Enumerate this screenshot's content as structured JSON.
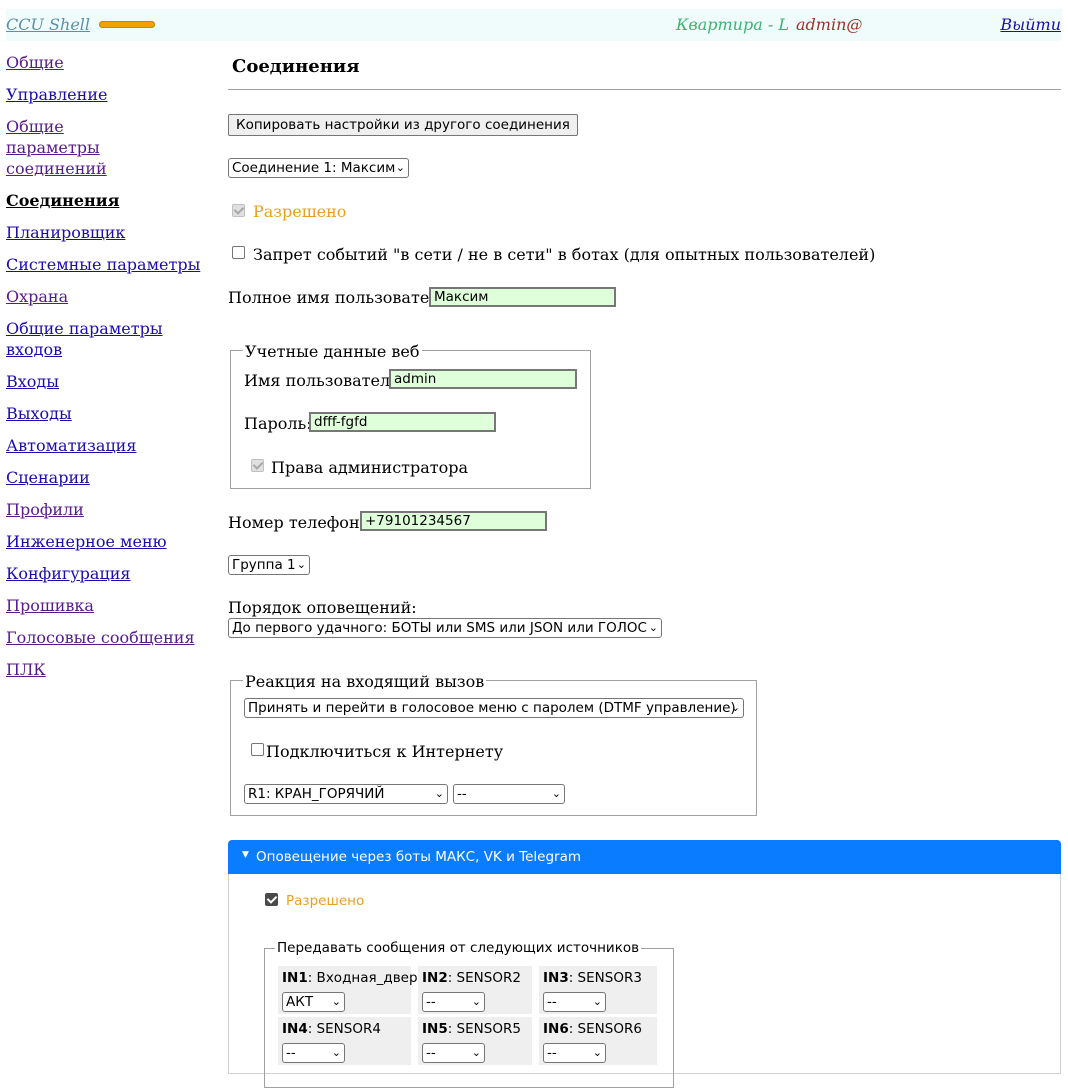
{
  "header": {
    "brand": "CCU Shell",
    "place": "Квартира - L",
    "user": "admin@",
    "logout": "Выйти"
  },
  "sidebar": {
    "items": [
      {
        "label": "Общие"
      },
      {
        "label": "Управление"
      },
      {
        "label": "Общие параметры соединений"
      },
      {
        "label": "Соединения"
      },
      {
        "label": "Планировщик"
      },
      {
        "label": "Системные параметры"
      },
      {
        "label": "Охрана"
      },
      {
        "label": "Общие параметры входов"
      },
      {
        "label": "Входы"
      },
      {
        "label": "Выходы"
      },
      {
        "label": "Автоматизация"
      },
      {
        "label": "Сценарии"
      },
      {
        "label": "Профили"
      },
      {
        "label": "Инженерное меню"
      },
      {
        "label": "Конфигурация"
      },
      {
        "label": "Прошивка"
      },
      {
        "label": "Голосовые сообщения"
      },
      {
        "label": "ПЛК"
      }
    ]
  },
  "main": {
    "title": "Соединения",
    "copy_button": "Копировать настройки из другого соединения",
    "connection_select": "Соединение 1: Максим",
    "allowed_label": "Разрешено",
    "ban_events_label": "Запрет событий \"в сети / не в сети\" в ботах (для опытных пользователей)",
    "fullname_label": "Полное имя пользователя:",
    "fullname_value": "Максим",
    "web": {
      "legend": "Учетные данные веб",
      "username_label": "Имя пользователя:",
      "username_value": "admin",
      "password_label": "Пароль:",
      "password_value": "dfff-fgfd",
      "admin_label": "Права администратора"
    },
    "phone_label": "Номер телефона:",
    "phone_value": "+79101234567",
    "group_select": "Группа 1",
    "notify_order_label": "Порядок оповещений:",
    "notify_order_select": "До первого удачного: БОТЫ или SMS или JSON или ГОЛОС",
    "incoming": {
      "legend": "Реакция на входящий вызов",
      "action_select": "Принять и перейти в голосовое меню с паролем (DTMF управление)",
      "internet_label": "Подключиться к Интернету",
      "relay_select": "R1: КРАН_ГОРЯЧИЙ",
      "relay_action_select": "--"
    },
    "bots": {
      "header": "Оповещение через боты МАКС, VK и Telegram",
      "allowed_label": "Разрешено",
      "sources_legend": "Передавать сообщения от следующих источников",
      "sources": [
        {
          "id": "IN1",
          "name": ": Входная_дверь",
          "value": "АКТ"
        },
        {
          "id": "IN2",
          "name": ": SENSOR2",
          "value": "--"
        },
        {
          "id": "IN3",
          "name": ": SENSOR3",
          "value": "--"
        },
        {
          "id": "IN4",
          "name": ": SENSOR4",
          "value": "--"
        },
        {
          "id": "IN5",
          "name": ": SENSOR5",
          "value": "--"
        },
        {
          "id": "IN6",
          "name": ": SENSOR6",
          "value": "--"
        }
      ]
    }
  },
  "icons": {
    "select_chevron": "chevron-down-icon",
    "collapse_triangle": "triangle-down-icon"
  },
  "colors": {
    "accent_blue": "#0a7cff",
    "input_bg": "#dfffda",
    "allowed_orange": "#e8a020",
    "place_green": "#3cb371",
    "user_red": "#a0302a"
  }
}
